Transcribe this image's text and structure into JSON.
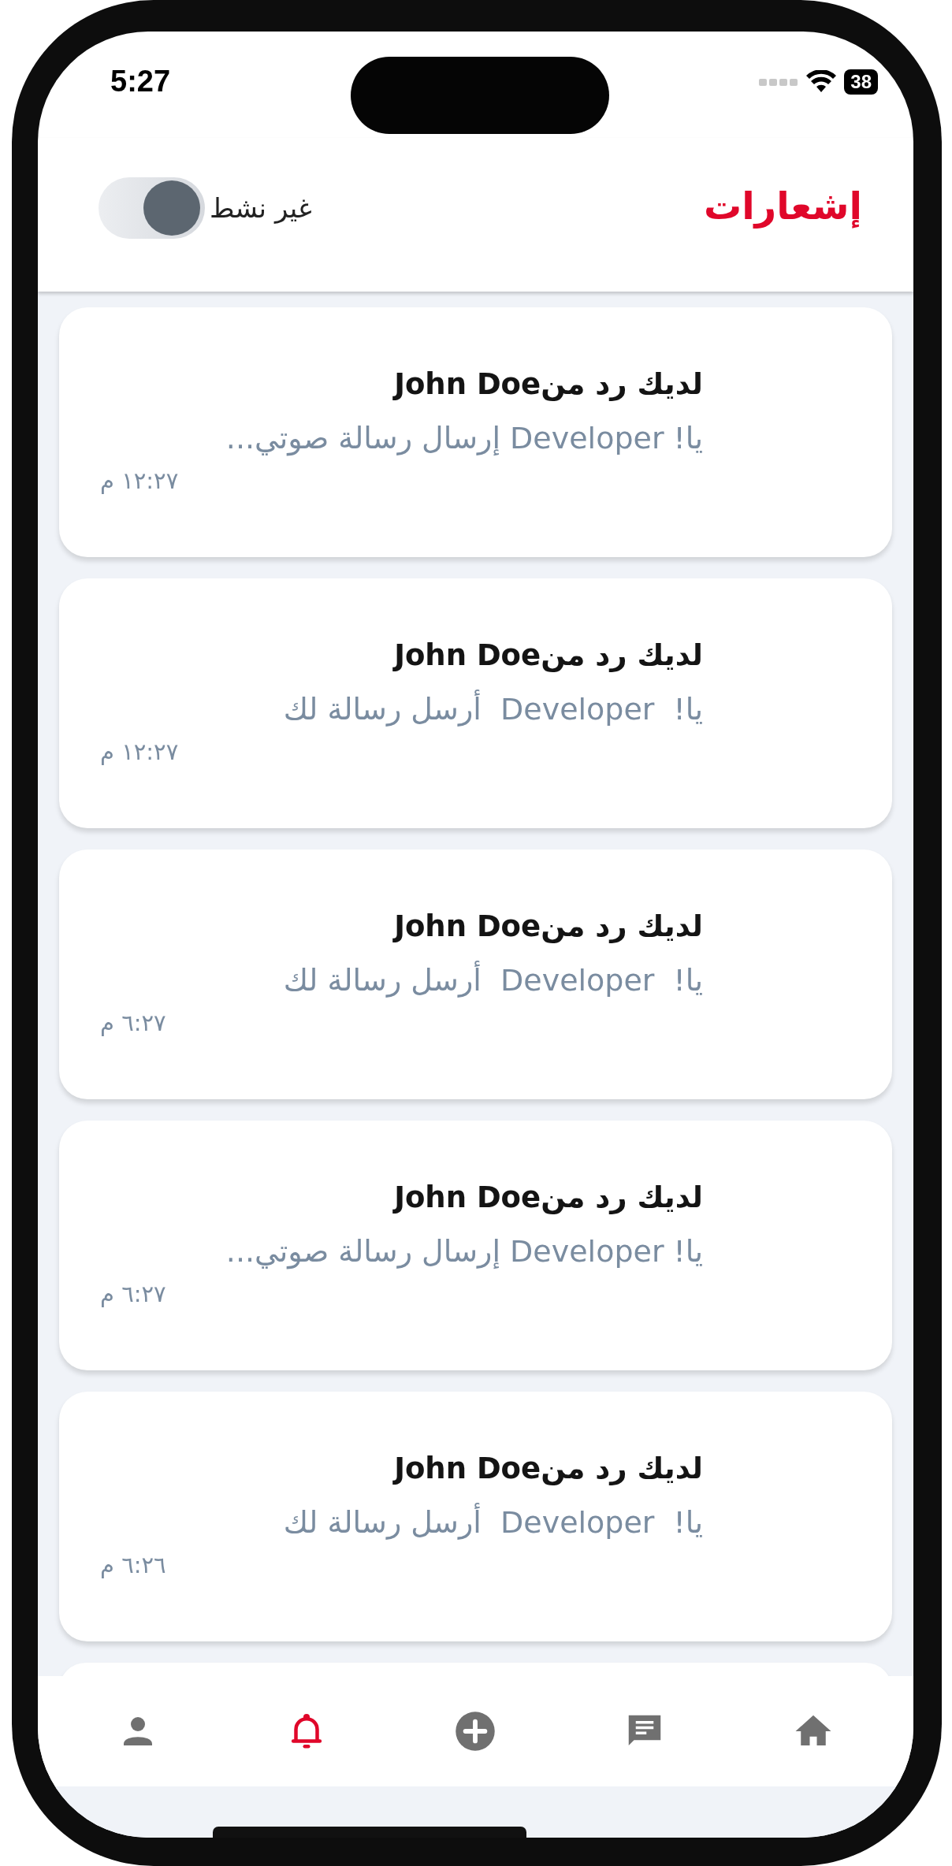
{
  "status_bar": {
    "time": "5:27",
    "battery": "38"
  },
  "header": {
    "title": "إشعارات",
    "toggle": {
      "label": "غير نشط",
      "on": false
    }
  },
  "notifications": [
    {
      "title": "لديك رد منJohn Doe",
      "message": "يا! Developer إرسال رسالة صوتي...",
      "time": "١٢:٢٧ م"
    },
    {
      "title": "لديك رد منJohn Doe",
      "message": "يا!  Developer  أرسل رسالة لك",
      "time": "١٢:٢٧ م"
    },
    {
      "title": "لديك رد منJohn Doe",
      "message": "يا!  Developer  أرسل رسالة لك",
      "time": "٦:٢٧ م"
    },
    {
      "title": "لديك رد منJohn Doe",
      "message": "يا! Developer إرسال رسالة صوتي...",
      "time": "٦:٢٧ م"
    },
    {
      "title": "لديك رد منJohn Doe",
      "message": "يا!  Developer  أرسل رسالة لك",
      "time": "٦:٢٦ م"
    }
  ],
  "nav": [
    {
      "kind": "profile",
      "selected": false
    },
    {
      "kind": "notifications",
      "selected": true
    },
    {
      "kind": "add",
      "selected": false
    },
    {
      "kind": "messages",
      "selected": false
    },
    {
      "kind": "home",
      "selected": false
    }
  ]
}
